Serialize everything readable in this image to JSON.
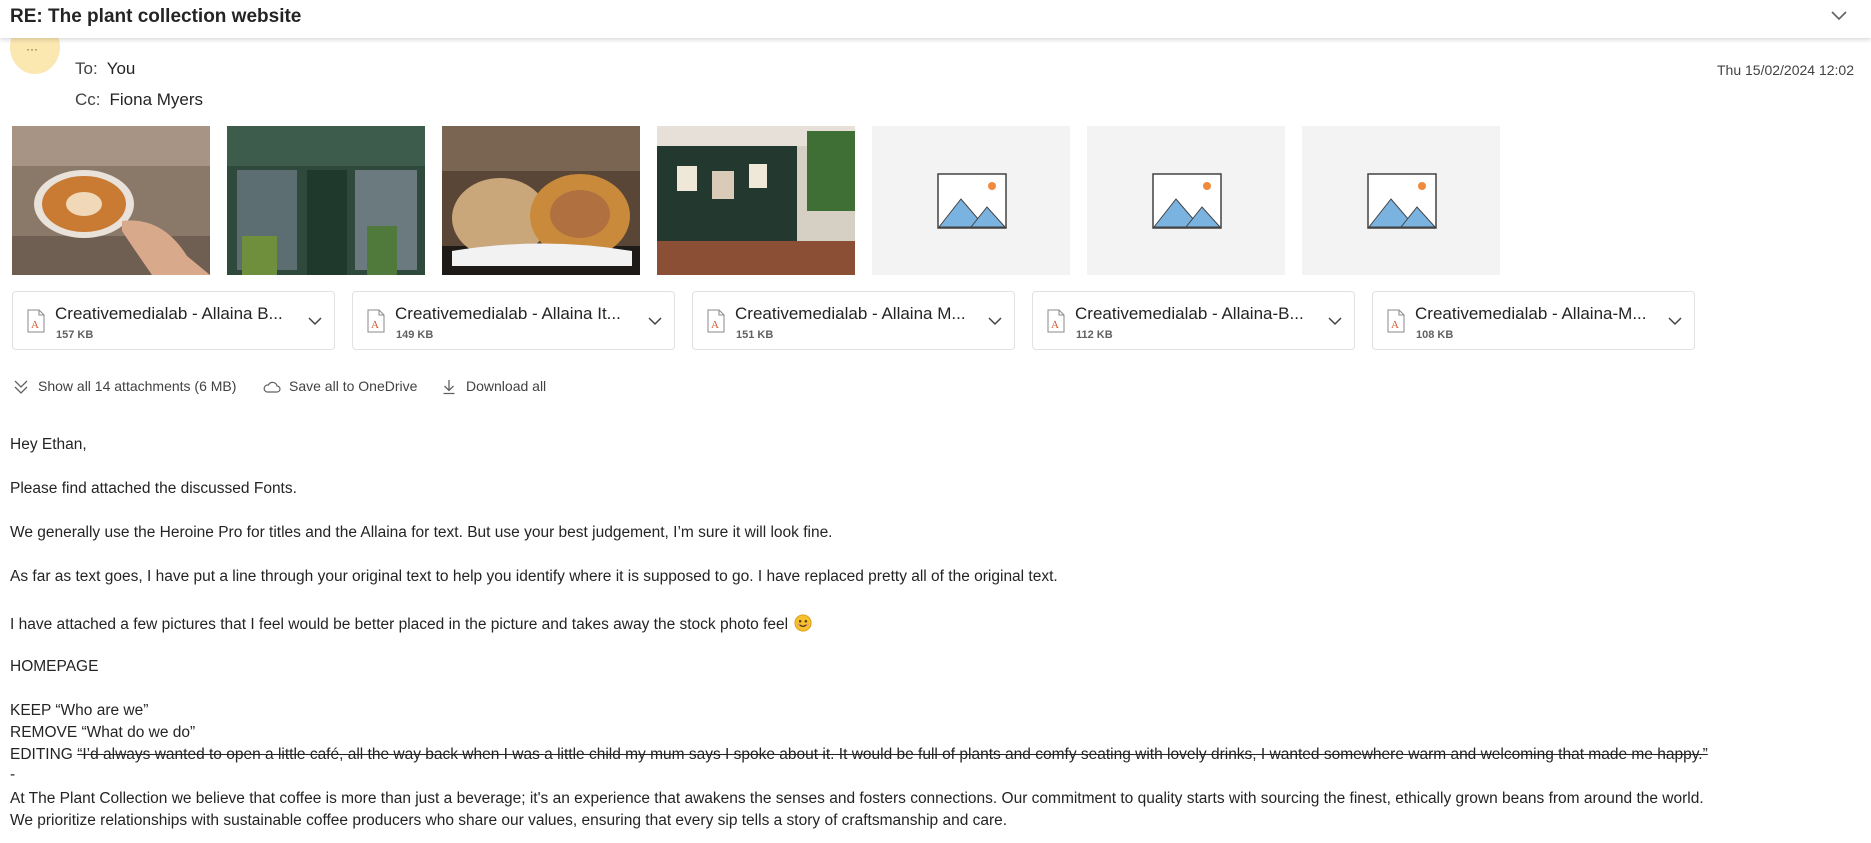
{
  "email": {
    "subject": "RE: The plant collection website",
    "to_label": "To:",
    "to_value": "You",
    "cc_label": "Cc:",
    "cc_value": "Fiona Myers",
    "date": "Thu 15/02/2024 12:02"
  },
  "thumbnails": [
    {
      "kind": "photo",
      "subject": "latte-art-cup"
    },
    {
      "kind": "photo",
      "subject": "shop-front-plant-collection"
    },
    {
      "kind": "photo",
      "subject": "bread-and-pastries"
    },
    {
      "kind": "photo",
      "subject": "cafe-interior"
    },
    {
      "kind": "placeholder",
      "icon": "image-icon"
    },
    {
      "kind": "placeholder",
      "icon": "image-icon"
    },
    {
      "kind": "placeholder",
      "icon": "image-icon"
    }
  ],
  "attachments": [
    {
      "name": "Creativemedialab - Allaina B...",
      "size": "157 KB",
      "icon": "font-file-icon"
    },
    {
      "name": "Creativemedialab - Allaina It...",
      "size": "149 KB",
      "icon": "font-file-icon"
    },
    {
      "name": "Creativemedialab - Allaina M...",
      "size": "151 KB",
      "icon": "font-file-icon"
    },
    {
      "name": "Creativemedialab - Allaina-B...",
      "size": "112 KB",
      "icon": "font-file-icon"
    },
    {
      "name": "Creativemedialab - Allaina-M...",
      "size": "108 KB",
      "icon": "font-file-icon"
    }
  ],
  "actions": {
    "show_all": "Show all 14 attachments (6 MB)",
    "save_onedrive": "Save all to OneDrive",
    "download_all": "Download all"
  },
  "body": {
    "greeting": "Hey Ethan,",
    "p1": "Please find attached the discussed Fonts.",
    "p2": "We generally use the Heroine Pro for titles and the Allaina for text. But use your best judgement, I’m sure it will look fine.",
    "p3": "As far as text goes, I have put a line through your original text to help you identify where it is supposed to go. I have replaced pretty all of the original text.",
    "p4": "I have attached a few pictures that I feel would be better placed in the picture and takes away the stock photo feel",
    "heading": "HOMEPAGE",
    "keep": "KEEP “Who are we”",
    "remove": "REMOVE “What do we do”",
    "editing_label": "EDITING",
    "editing_struck": "“I’d always wanted to open a little café, all the way back when I was a little child my mum says I spoke about it. It would be full of plants and comfy seating with lovely drinks, I wanted somewhere warm and welcoming that made me happy.”",
    "dash": "-",
    "p5_line1": "At The Plant Collection we believe that coffee is more than just a beverage; it's an experience that awakens the senses and fosters connections. Our commitment to quality starts with sourcing the finest, ethically grown beans from around the world.",
    "p5_line2": "We prioritize relationships with sustainable coffee producers who share our values, ensuring that every sip tells a story of craftsmanship and care."
  },
  "colors": {
    "accent_orange": "#d9552b",
    "placeholder_blue": "#7bb3e0",
    "avatar_bg": "#fbe7b0"
  }
}
